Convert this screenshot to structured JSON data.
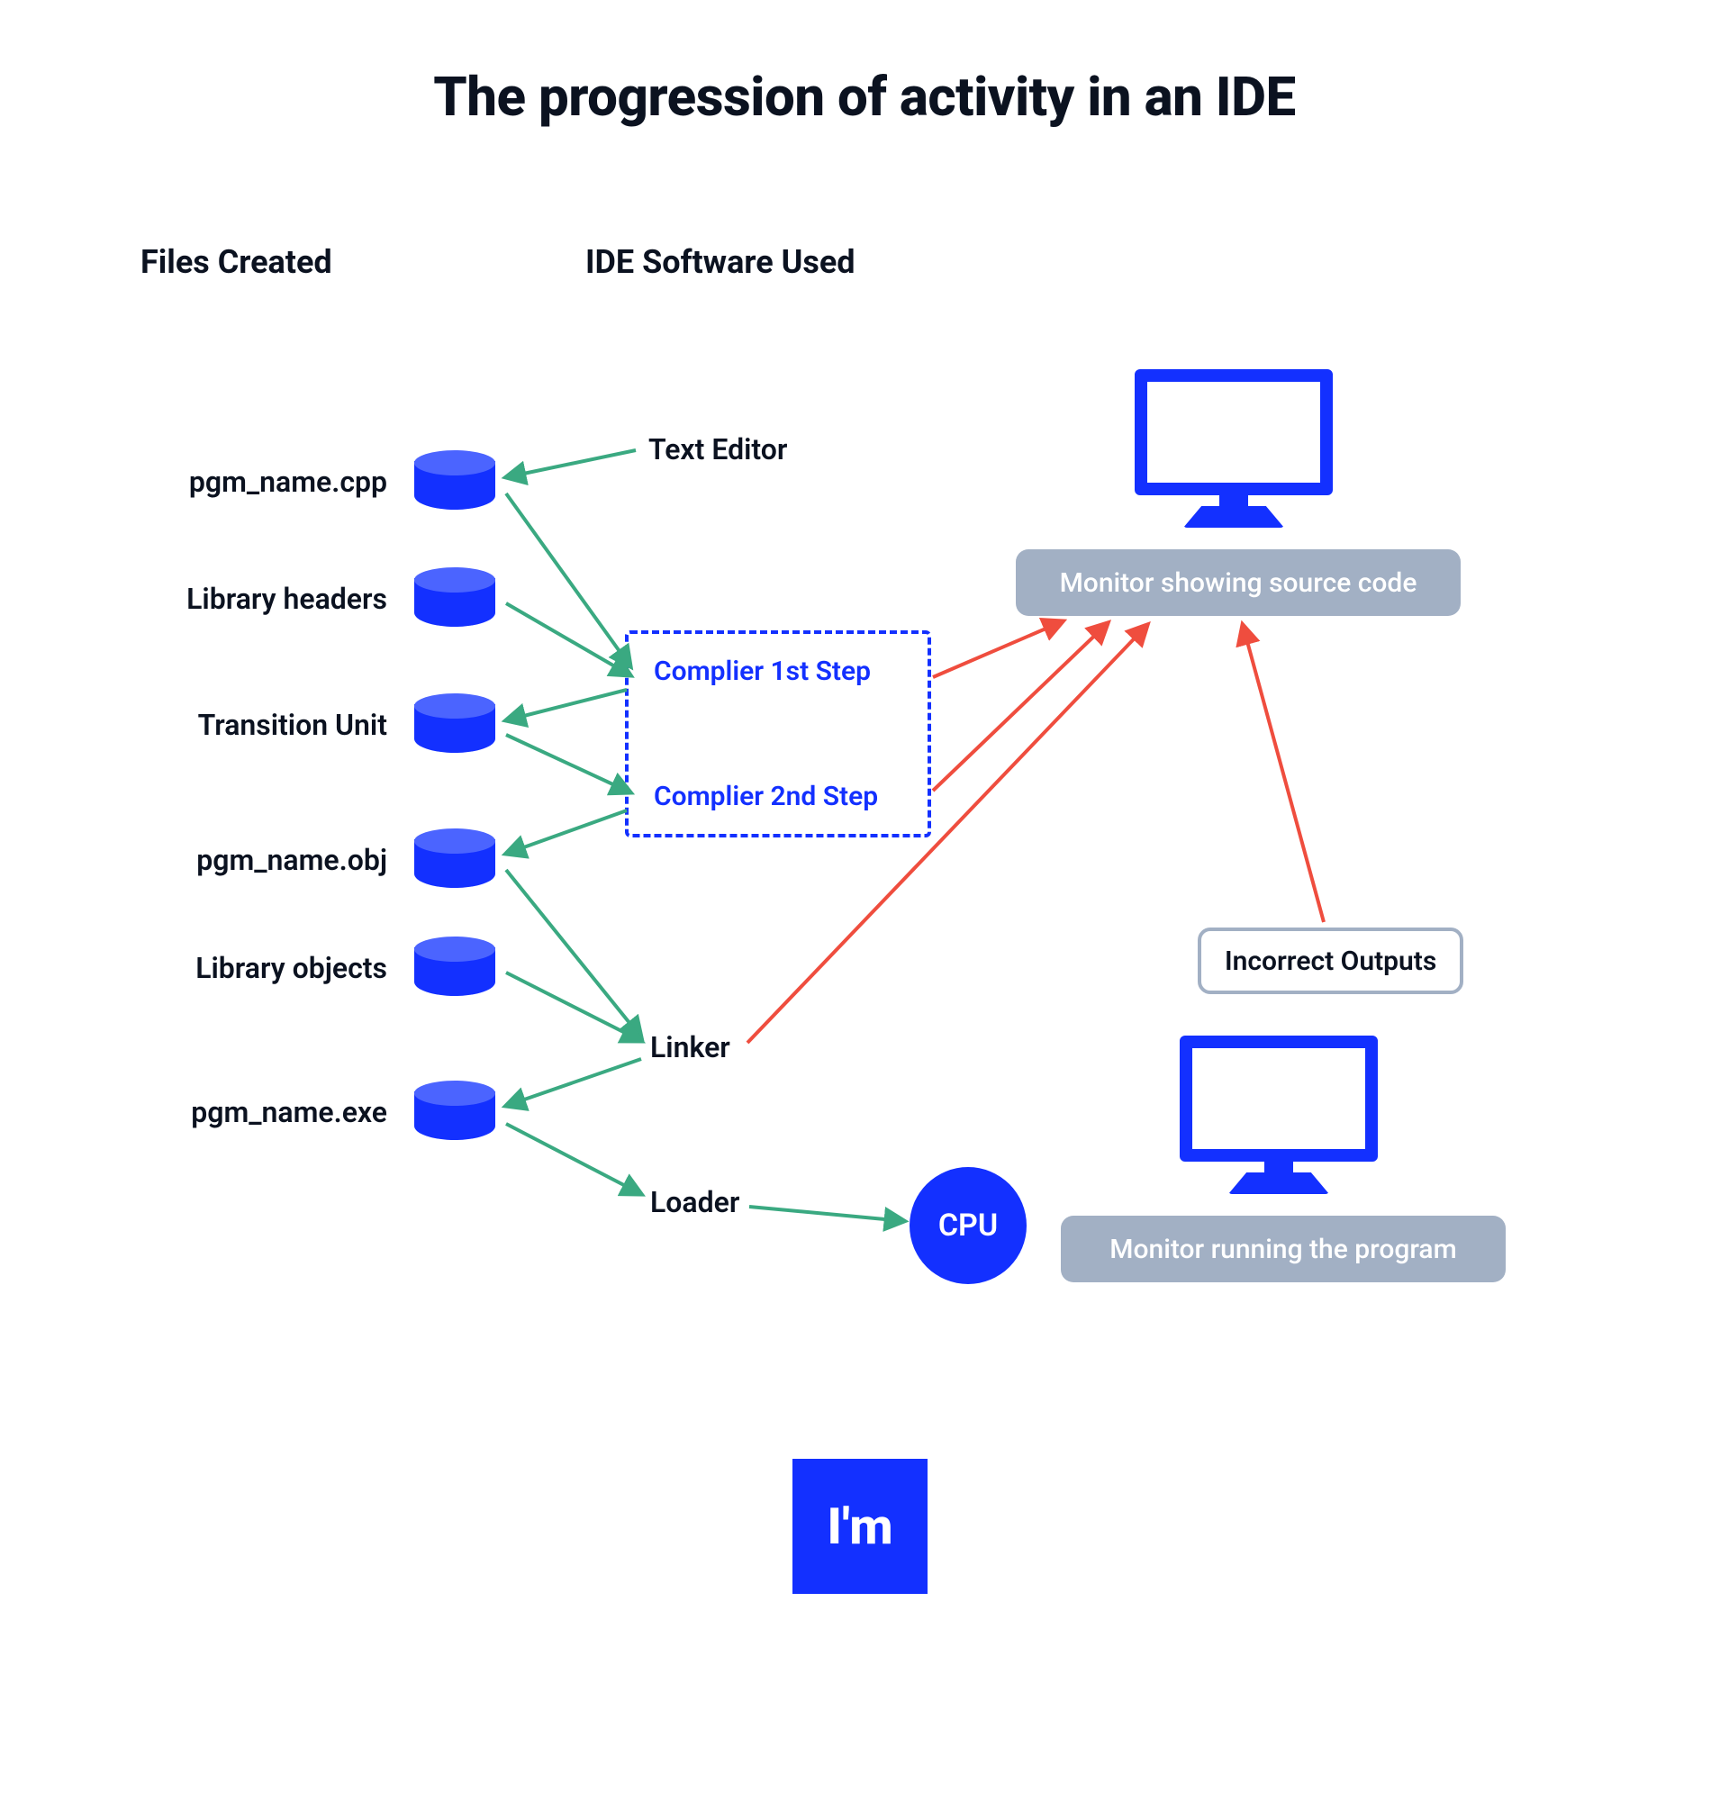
{
  "title": "The progression of activity in an IDE",
  "columns": {
    "files": "Files Created",
    "software": "IDE Software Used"
  },
  "files": {
    "cpp": "pgm_name.cpp",
    "headers": "Library headers",
    "tu": "Transition Unit",
    "obj": "pgm_name.obj",
    "libobj": "Library objects",
    "exe": "pgm_name.exe"
  },
  "software": {
    "editor": "Text Editor",
    "compiler_step1": "Complier 1st Step",
    "compiler_step2": "Complier 2nd Step",
    "linker": "Linker",
    "loader": "Loader"
  },
  "monitor": {
    "source": "Monitor showing source code",
    "running": "Monitor running the program"
  },
  "incorrect": "Incorrect Outputs",
  "cpu": "CPU",
  "logo": "I'm",
  "colors": {
    "primary": "#1330ff",
    "muted_box": "#a2b0c4",
    "green_arrow": "#3aa981",
    "red_arrow": "#ef4d3e",
    "text": "#0b1220"
  }
}
